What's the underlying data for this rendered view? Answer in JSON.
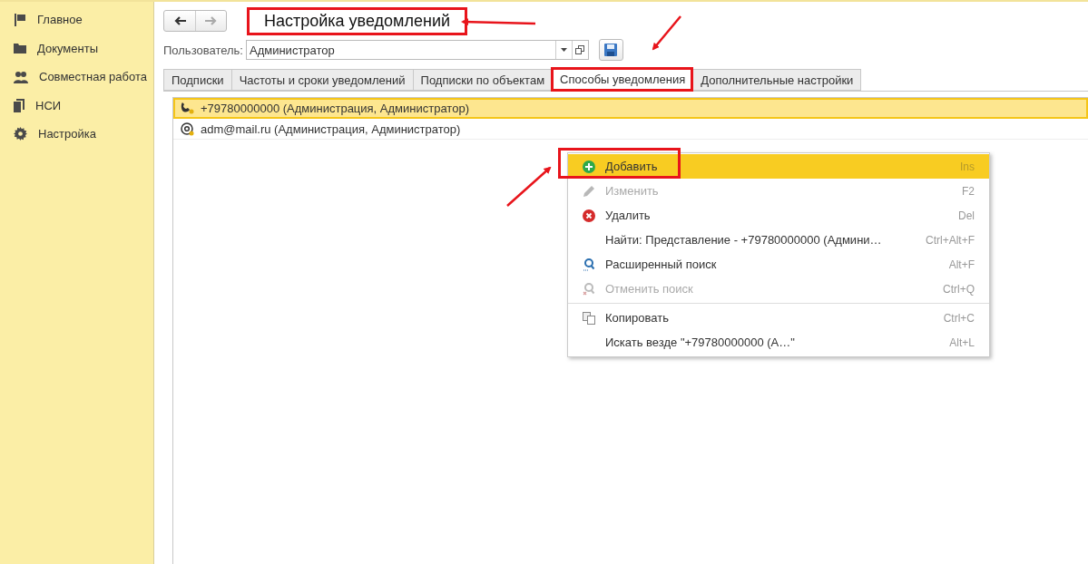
{
  "sidebar": {
    "items": [
      {
        "label": "Главное"
      },
      {
        "label": "Документы"
      },
      {
        "label": "Совместная работа"
      },
      {
        "label": "НСИ"
      },
      {
        "label": "Настройка"
      }
    ]
  },
  "form": {
    "title": "Настройка уведомлений",
    "title_highlighted": true,
    "user_label": "Пользователь:",
    "user_value": "Администратор",
    "tabs": [
      {
        "label": "Подписки",
        "selected": false,
        "highlighted": false
      },
      {
        "label": "Частоты и сроки уведомлений",
        "selected": false,
        "highlighted": false
      },
      {
        "label": "Подписки по объектам",
        "selected": false,
        "highlighted": false
      },
      {
        "label": "Способы уведомления",
        "selected": true,
        "highlighted": true
      },
      {
        "label": "Дополнительные настройки",
        "selected": false,
        "highlighted": false
      }
    ],
    "rows": [
      {
        "text": "+79780000000 (Администрация, Администратор)",
        "selected": true
      },
      {
        "text": "adm@mail.ru (Администрация, Администратор)",
        "selected": false
      }
    ]
  },
  "context_menu": {
    "items": [
      {
        "kind": "item",
        "label": "Добавить",
        "shortcut": "Ins",
        "disabled": false,
        "selected": true,
        "highlighted": true
      },
      {
        "kind": "item",
        "label": "Изменить",
        "shortcut": "F2",
        "disabled": true,
        "selected": false,
        "highlighted": false
      },
      {
        "kind": "item",
        "label": "Удалить",
        "shortcut": "Del",
        "disabled": false,
        "selected": false,
        "highlighted": false
      },
      {
        "kind": "item",
        "label": "Найти: Представление - +79780000000 (Админи…",
        "shortcut": "Ctrl+Alt+F",
        "disabled": false,
        "selected": false,
        "highlighted": false
      },
      {
        "kind": "item",
        "label": "Расширенный поиск",
        "shortcut": "Alt+F",
        "disabled": false,
        "selected": false,
        "highlighted": false
      },
      {
        "kind": "item",
        "label": "Отменить поиск",
        "shortcut": "Ctrl+Q",
        "disabled": true,
        "selected": false,
        "highlighted": false
      },
      {
        "kind": "separator"
      },
      {
        "kind": "item",
        "label": "Копировать",
        "shortcut": "Ctrl+C",
        "disabled": false,
        "selected": false,
        "highlighted": false
      },
      {
        "kind": "item",
        "label": "Искать везде \"+79780000000 (А…\"",
        "shortcut": "Alt+L",
        "disabled": false,
        "selected": false,
        "highlighted": false
      }
    ]
  }
}
